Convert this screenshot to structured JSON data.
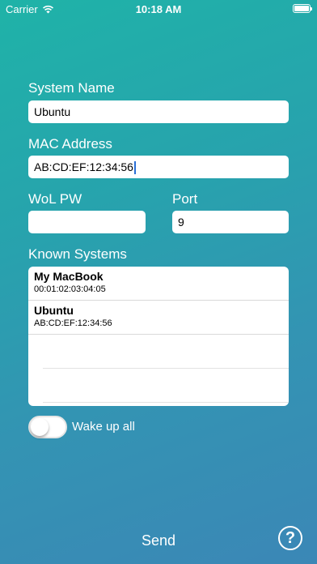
{
  "status_bar": {
    "carrier": "Carrier",
    "time": "10:18 AM"
  },
  "form": {
    "system_name_label": "System Name",
    "system_name_value": "Ubuntu",
    "mac_label": "MAC Address",
    "mac_value": "AB:CD:EF:12:34:56",
    "wol_pw_label": "WoL PW",
    "wol_pw_value": "",
    "port_label": "Port",
    "port_value": "9"
  },
  "known_systems": {
    "label": "Known Systems",
    "items": [
      {
        "name": "My MacBook",
        "mac": "00:01:02:03:04:05"
      },
      {
        "name": "Ubuntu",
        "mac": "AB:CD:EF:12:34:56"
      }
    ]
  },
  "wake_all": {
    "label": "Wake up all",
    "on": false
  },
  "actions": {
    "send_label": "Send",
    "help_label": "?"
  }
}
